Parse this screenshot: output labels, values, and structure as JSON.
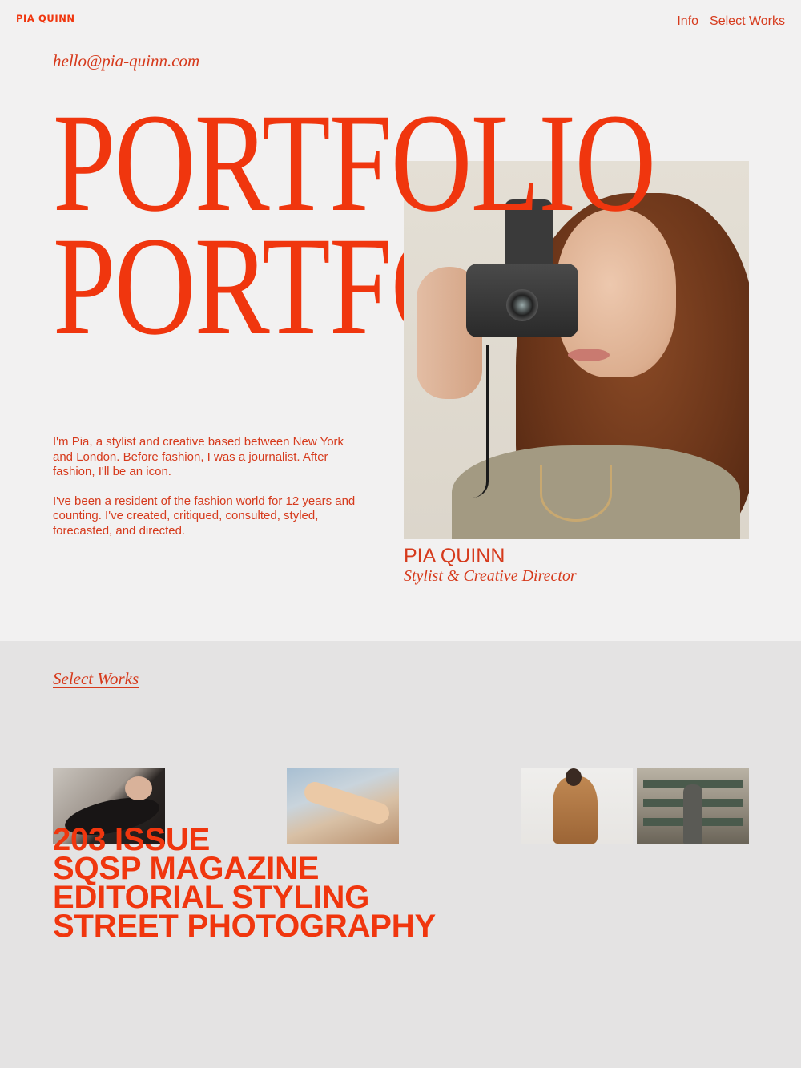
{
  "header": {
    "logo": "PIA QUINN",
    "nav": [
      {
        "label": "Info"
      },
      {
        "label": "Select Works"
      }
    ]
  },
  "hero": {
    "email": "hello@pia-quinn.com",
    "title_line_1": "PORTFOLIO",
    "title_line_2": "PORTFOLIO",
    "intro_paragraphs": [
      "I'm Pia, a stylist and creative based between New York and London. Before fashion, I was a journalist. After fashion, I'll be an icon.",
      "I've been a resident of the fashion world for 12 years and counting. I've created, critiqued, consulted, styled, forecasted, and directed."
    ],
    "caption_name": "PIA QUINN",
    "caption_role": "Stylist & Creative Director"
  },
  "works": {
    "heading": "Select Works",
    "projects": [
      {
        "title": "203 ISSUE"
      },
      {
        "title": "SQSP MAGAZINE"
      },
      {
        "title": "EDITORIAL STYLING"
      },
      {
        "title": "STREET PHOTOGRAPHY"
      }
    ]
  },
  "colors": {
    "accent": "#f0360e",
    "text": "#d63a1c",
    "background": "#f2f1f1",
    "works_background": "#e4e3e3"
  }
}
